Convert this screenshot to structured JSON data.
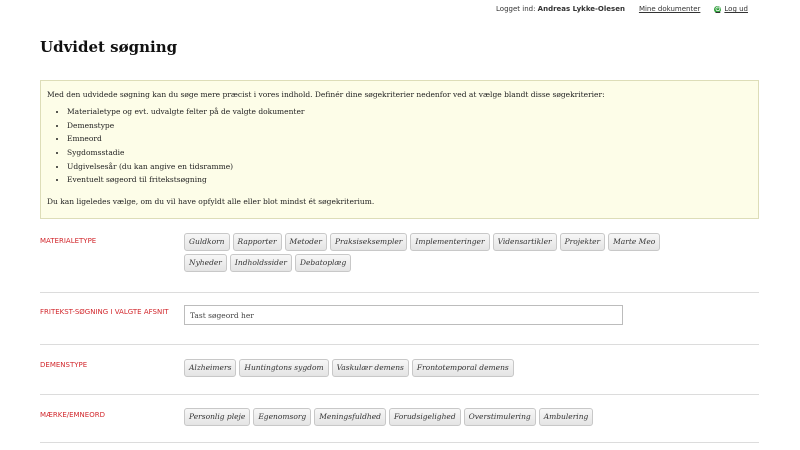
{
  "topbar": {
    "logged_in_prefix": "Logget ind:",
    "user_name": "Andreas Lykke-Olesen",
    "my_documents": "Mine dokumenter",
    "logout": "Log ud"
  },
  "page_title": "Udvidet søgning",
  "info": {
    "intro": "Med den udvidede søgning kan du søge mere præcist i vores indhold. Definér dine søgekriterier nedenfor ved at vælge blandt disse søgekriterier:",
    "criteria": [
      "Materialetype og evt. udvalgte felter på de valgte dokumenter",
      "Demenstype",
      "Emneord",
      "Sygdomsstadie",
      "Udgivelsesår (du kan angive en tidsramme)",
      "Eventuelt søgeord til fritekstsøgning"
    ],
    "outro": "Du kan ligeledes vælge, om du vil have opfyldt alle eller blot mindst ét søgekriterium."
  },
  "materialetype": {
    "label": "MATERIALETYPE",
    "tags": [
      "Guldkorn",
      "Rapporter",
      "Metoder",
      "Praksiseksempler",
      "Implementeringer",
      "Vidensartikler",
      "Projekter",
      "Marte Meo",
      "Nyheder",
      "Indholdssider",
      "Debatoplæg"
    ]
  },
  "fritekst": {
    "label": "FRITEKST-SØGNING I VALGTE AFSNIT",
    "placeholder": "Tast søgeord her"
  },
  "demenstype": {
    "label": "DEMENSTYPE",
    "tags": [
      "Alzheimers",
      "Huntingtons sygdom",
      "Vaskulær demens",
      "Frontotemporal demens"
    ]
  },
  "emneord": {
    "label": "MÆRKE/EMNEORD",
    "tags": [
      "Personlig pleje",
      "Egenomsorg",
      "Meningsfuldhed",
      "Forudsigelighed",
      "Overstimulering",
      "Ambulering"
    ]
  },
  "colors": {
    "label_red": "#d2282d",
    "info_bg": "#fdfde8",
    "logout_green": "#2e9e3a"
  }
}
